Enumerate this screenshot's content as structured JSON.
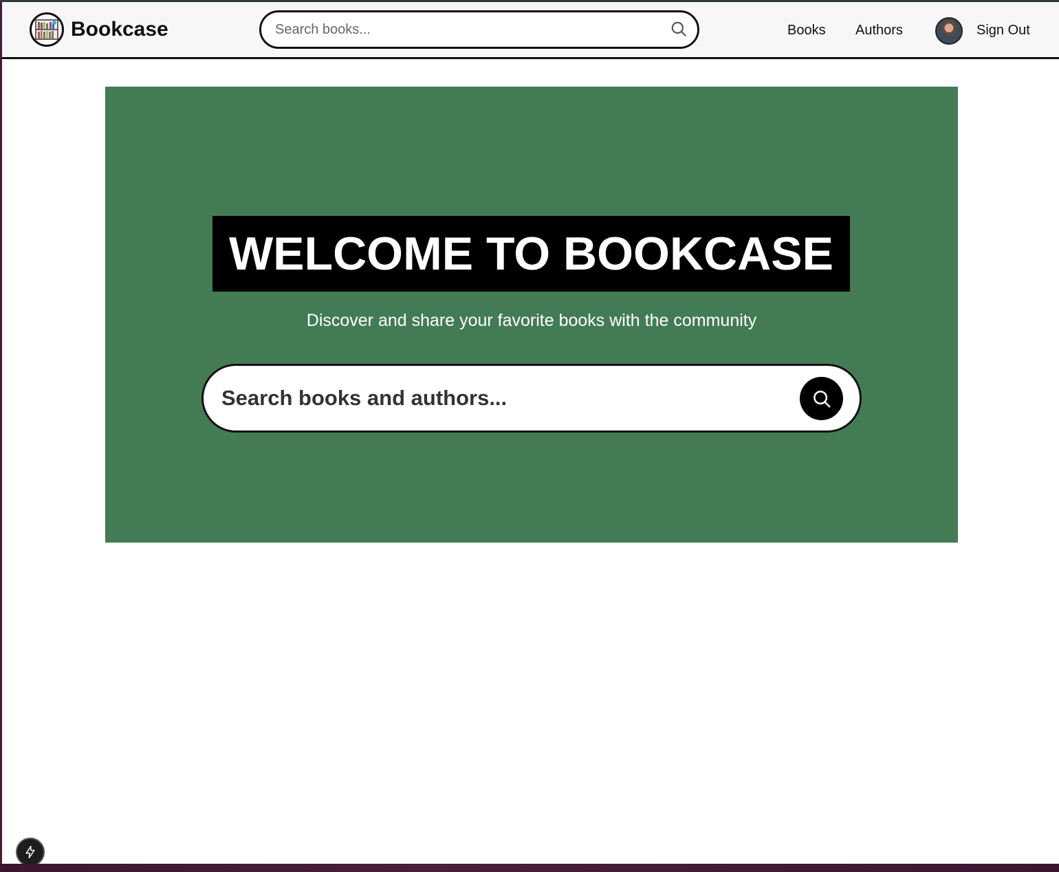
{
  "header": {
    "brand": "Bookcase",
    "search_placeholder": "Search books...",
    "nav": {
      "books": "Books",
      "authors": "Authors",
      "sign_out": "Sign Out"
    }
  },
  "hero": {
    "title": "WELCOME TO BOOKCASE",
    "subtitle": "Discover and share your favorite books with the community",
    "search_placeholder": "Search books and authors...",
    "background_color": "#437c54"
  },
  "icons": {
    "logo": "bookshelf-icon",
    "search": "search-icon",
    "dev_badge": "lightning-icon"
  }
}
